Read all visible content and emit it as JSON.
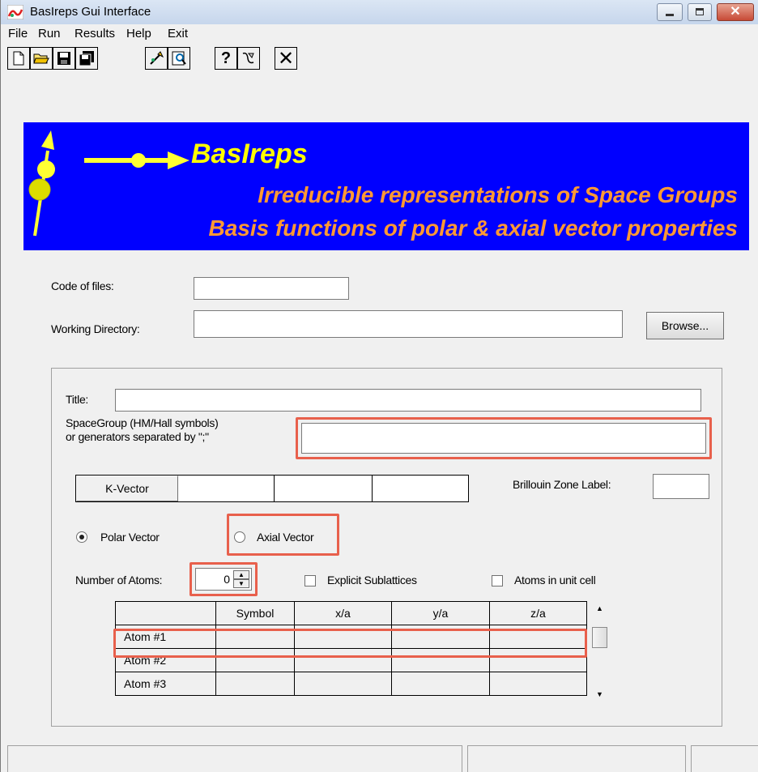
{
  "window": {
    "title": "BasIreps Gui Interface"
  },
  "menu": [
    "File",
    "Run",
    "Results",
    "Help",
    "Exit"
  ],
  "toolbar": {
    "buttons": [
      "new-file",
      "open-folder",
      "save",
      "save-all",
      "run",
      "view",
      "help",
      "about",
      "close"
    ]
  },
  "banner": {
    "title": "BasIreps",
    "line1": "Irreducible representations of Space Groups",
    "line2": "Basis functions of polar & axial vector properties"
  },
  "files": {
    "code_label": "Code of files:",
    "code_value": "",
    "workdir_label": "Working Directory:",
    "workdir_value": "",
    "browse_label": "Browse..."
  },
  "form": {
    "title_label": "Title:",
    "title_value": "",
    "spacegroup_label_1": "SpaceGroup (HM/Hall symbols)",
    "spacegroup_label_2": "or generators separated by \";\"",
    "spacegroup_value": "",
    "kvector_label": "K-Vector",
    "brillouin_label": "Brillouin Zone Label:",
    "brillouin_value": "",
    "polar_label": "Polar Vector",
    "axial_label": "Axial Vector",
    "polar_checked": true,
    "num_atoms_label": "Number of Atoms:",
    "num_atoms_value": "0",
    "explicit_sublattices_label": "Explicit Sublattices",
    "atoms_in_cell_label": "Atoms in unit cell"
  },
  "atoms_table": {
    "columns": [
      "Symbol",
      "x/a",
      "y/a",
      "z/a"
    ],
    "rows": [
      "Atom #1",
      "Atom #2",
      "Atom #3"
    ]
  },
  "colors": {
    "banner_bg": "#0000ff",
    "banner_title": "#ffff00",
    "banner_text": "#ff9933",
    "highlight": "#e8604c"
  }
}
